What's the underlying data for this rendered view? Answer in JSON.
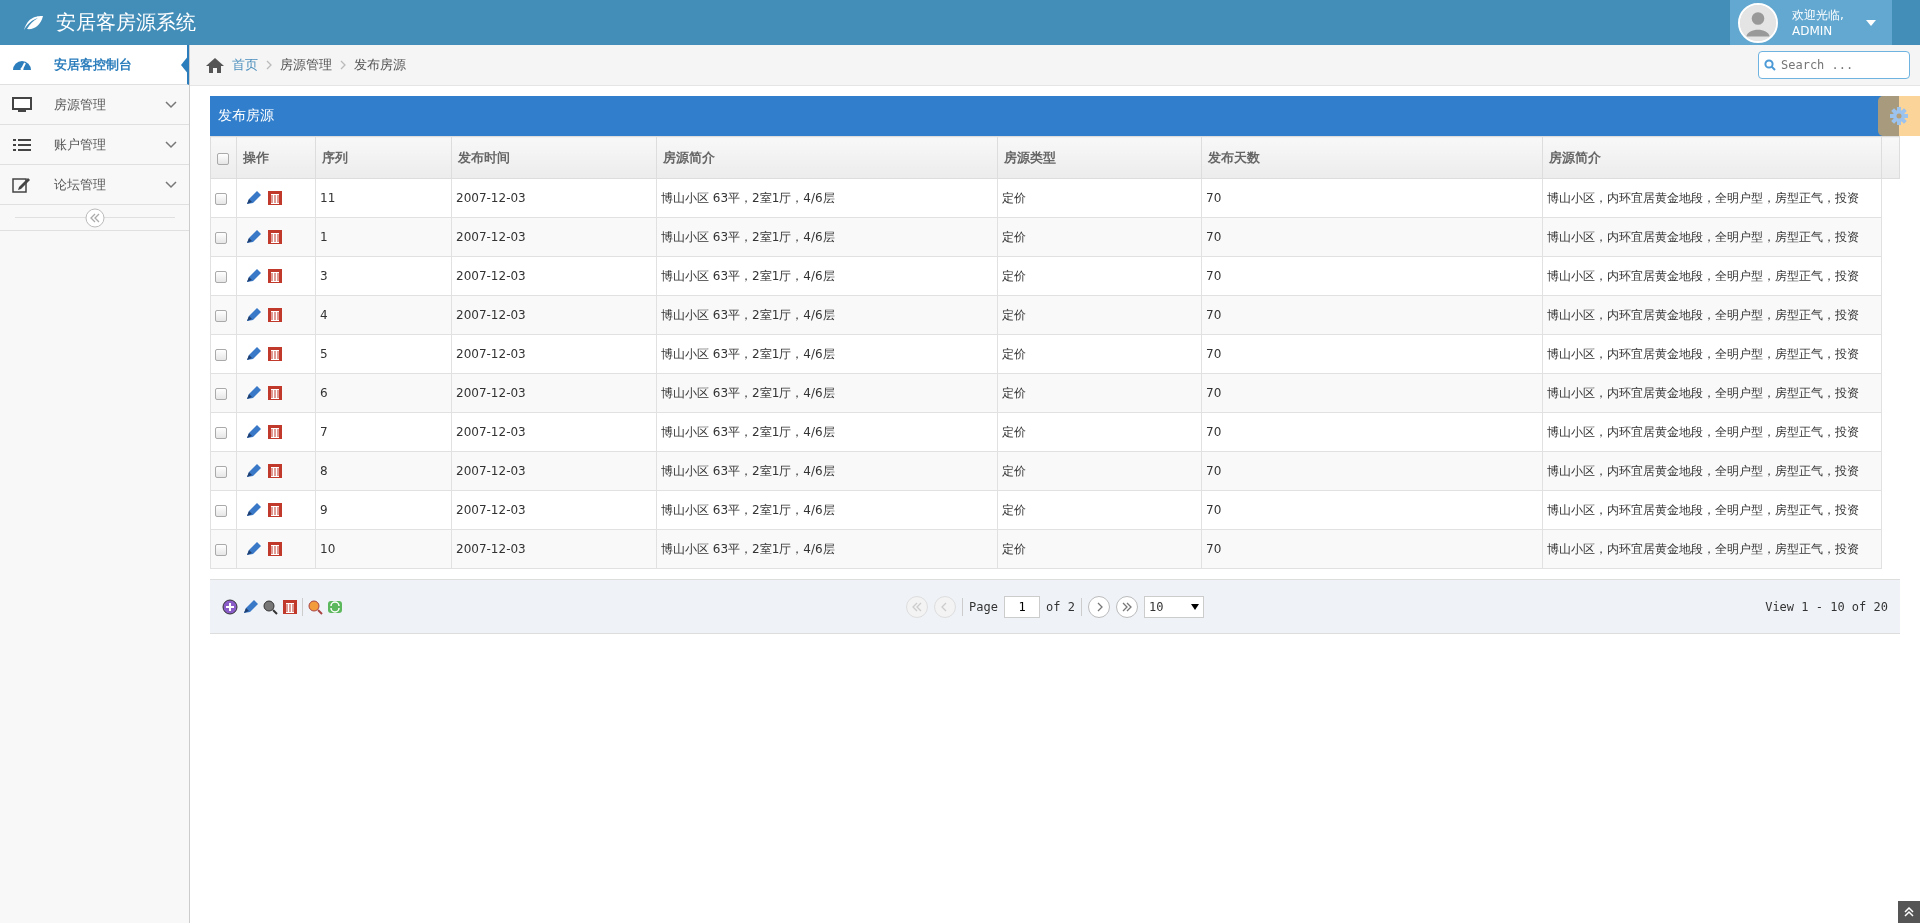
{
  "header": {
    "title": "安居客房源系统",
    "user": {
      "greeting": "欢迎光临,",
      "name": "ADMIN"
    }
  },
  "sidebar": {
    "items": [
      {
        "label": "安居客控制台",
        "selected": true,
        "expandable": false
      },
      {
        "label": "房源管理",
        "selected": false,
        "expandable": true
      },
      {
        "label": "账户管理",
        "selected": false,
        "expandable": true
      },
      {
        "label": "论坛管理",
        "selected": false,
        "expandable": true
      }
    ]
  },
  "breadcrumb": [
    {
      "label": "首页",
      "link": true
    },
    {
      "label": "房源管理",
      "link": false
    },
    {
      "label": "发布房源",
      "link": false
    }
  ],
  "search": {
    "placeholder": "Search ..."
  },
  "panel": {
    "title": "发布房源",
    "table": {
      "select_all_checked": false,
      "columns": [
        "操作",
        "序列",
        "发布时间",
        "房源简介",
        "房源类型",
        "发布天数",
        "房源简介"
      ],
      "rows": [
        {
          "selected": false,
          "cells": [
            "",
            "11",
            "2007-12-03",
            "博山小区 63平，2室1厅，4/6层",
            "定价",
            "70",
            "博山小区，内环宜居黄金地段，全明户型，房型正气，投资"
          ]
        },
        {
          "selected": false,
          "cells": [
            "",
            "1",
            "2007-12-03",
            "博山小区 63平，2室1厅，4/6层",
            "定价",
            "70",
            "博山小区，内环宜居黄金地段，全明户型，房型正气，投资"
          ]
        },
        {
          "selected": false,
          "cells": [
            "",
            "3",
            "2007-12-03",
            "博山小区 63平，2室1厅，4/6层",
            "定价",
            "70",
            "博山小区，内环宜居黄金地段，全明户型，房型正气，投资"
          ]
        },
        {
          "selected": false,
          "cells": [
            "",
            "4",
            "2007-12-03",
            "博山小区 63平，2室1厅，4/6层",
            "定价",
            "70",
            "博山小区，内环宜居黄金地段，全明户型，房型正气，投资"
          ]
        },
        {
          "selected": false,
          "cells": [
            "",
            "5",
            "2007-12-03",
            "博山小区 63平，2室1厅，4/6层",
            "定价",
            "70",
            "博山小区，内环宜居黄金地段，全明户型，房型正气，投资"
          ]
        },
        {
          "selected": false,
          "cells": [
            "",
            "6",
            "2007-12-03",
            "博山小区 63平，2室1厅，4/6层",
            "定价",
            "70",
            "博山小区，内环宜居黄金地段，全明户型，房型正气，投资"
          ]
        },
        {
          "selected": false,
          "cells": [
            "",
            "7",
            "2007-12-03",
            "博山小区 63平，2室1厅，4/6层",
            "定价",
            "70",
            "博山小区，内环宜居黄金地段，全明户型，房型正气，投资"
          ]
        },
        {
          "selected": false,
          "cells": [
            "",
            "8",
            "2007-12-03",
            "博山小区 63平，2室1厅，4/6层",
            "定价",
            "70",
            "博山小区，内环宜居黄金地段，全明户型，房型正气，投资"
          ]
        },
        {
          "selected": false,
          "cells": [
            "",
            "9",
            "2007-12-03",
            "博山小区 63平，2室1厅，4/6层",
            "定价",
            "70",
            "博山小区，内环宜居黄金地段，全明户型，房型正气，投资"
          ]
        },
        {
          "selected": false,
          "cells": [
            "",
            "10",
            "2007-12-03",
            "博山小区 63平，2室1厅，4/6层",
            "定价",
            "70",
            "博山小区，内环宜居黄金地段，全明户型，房型正气，投资"
          ]
        }
      ]
    },
    "pager": {
      "first_disabled": true,
      "prev_disabled": true,
      "next_disabled": false,
      "last_disabled": false,
      "page_label": "Page",
      "page": "1",
      "of": "of 2",
      "page_size": "10",
      "info": "View 1 - 10 of 20"
    }
  }
}
